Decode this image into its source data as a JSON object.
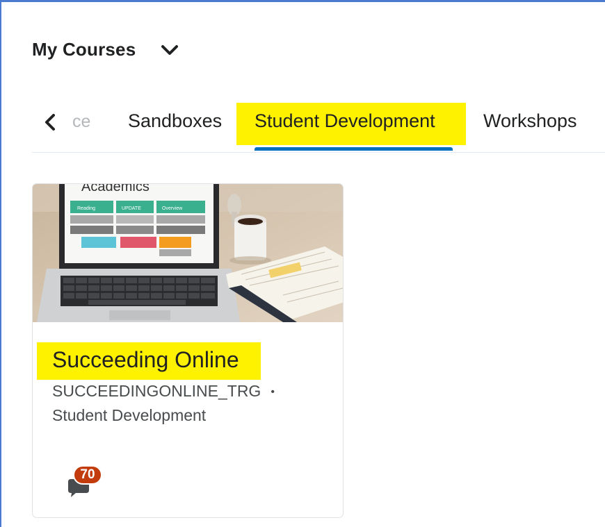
{
  "widget": {
    "title": "My Courses",
    "menu_icon": "chevron-down-icon"
  },
  "tabs": {
    "prev_icon": "chevron-left-icon",
    "partial_label": "ce",
    "items": [
      {
        "label": "Sandboxes",
        "active": false
      },
      {
        "label": "Student Development",
        "active": true
      },
      {
        "label": "Workshops",
        "active": false
      }
    ],
    "active_underline_color": "#006fbf"
  },
  "highlight_color": "#fff200",
  "course": {
    "name": "Succeeding Online",
    "code": "SUCCEEDINGONLINE_TRG",
    "separator": "•",
    "department": "Student Development",
    "image": {
      "screen_heading": "Academics",
      "screen_cells": [
        "Reading",
        "UPDATE",
        "Overview"
      ]
    },
    "notifications": {
      "icon": "discussion-bubble-icon",
      "count": "70",
      "badge_color": "#c23c0d"
    }
  }
}
